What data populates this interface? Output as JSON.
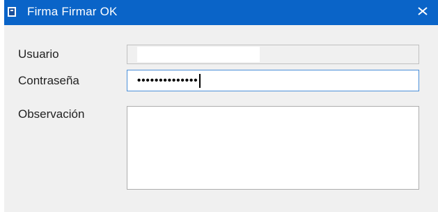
{
  "window": {
    "title": "Firma Firmar OK",
    "icon": "app-icon",
    "close_icon": "close-icon",
    "titlebar_color": "#0a64c8"
  },
  "form": {
    "user_label": "Usuario",
    "user_value": "",
    "password_label": "Contraseña",
    "password_value": "••••••••••••••",
    "observation_label": "Observación",
    "observation_value": ""
  }
}
